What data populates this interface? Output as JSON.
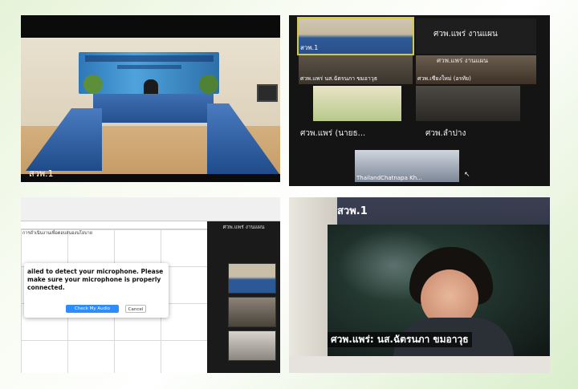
{
  "photo_meeting_room": {
    "room_label": "สวพ.1"
  },
  "photo_gallery": {
    "tiles": [
      {
        "name": "สวพ.1"
      },
      {
        "name": "ศวพ.แพร่ งานแผน"
      },
      {
        "name": "ศวพ.แพร่ งานแผน"
      },
      {
        "name": "ศวพ.แพร่ นส.ฉัตรนภา ขมอาวุธ"
      },
      {
        "name": "ศวพ.เชียงใหม่ (อรทัย)"
      },
      {
        "name": "ศวพ.แพร่ (นายธ..."
      },
      {
        "name": "ศวพ.ลำปาง"
      },
      {
        "name": "ThailandChatnapa Kh..."
      }
    ]
  },
  "photo_laptop": {
    "sheet_heading": "การดำเนินงานเพื่อตอบสนองนโยบาย",
    "dialog_message": "ailed to detect your microphone. Please make sure your microphone is properly connected.",
    "check_audio_button": "Check My Audio Devices",
    "cancel_button": "Cancel",
    "panel_title": "ศวพ.แพร่ งานแผน"
  },
  "photo_speaker": {
    "room_label": "สวพ.1",
    "speaker_name": "ศวพ.แพร่: นส.ฉัตรนภา ขมอาวุธ"
  }
}
